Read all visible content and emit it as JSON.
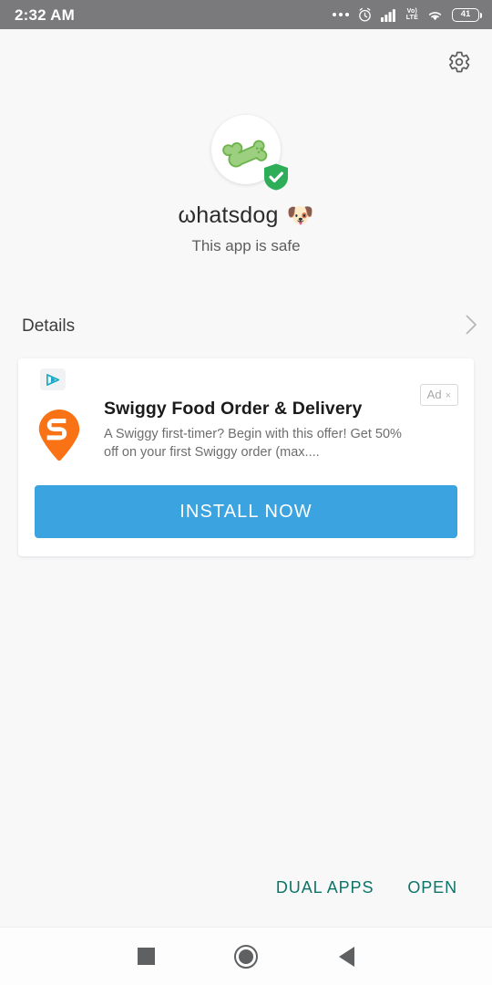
{
  "status_bar": {
    "time": "2:32 AM",
    "background": "#7a7a7c",
    "icons": [
      "more-dots-icon",
      "alarm-clock-icon",
      "signal-bars-icon",
      "volte-icon",
      "wifi-icon",
      "battery-icon"
    ],
    "volte_top": "Vo)",
    "volte_bottom": "LTE",
    "battery_level": "41"
  },
  "toolbar": {
    "settings_icon": "gear-icon"
  },
  "app": {
    "icon": "dog-bone-icon",
    "icon_background": "#ffffff",
    "bone_color": "#86c96a",
    "safe_badge_icon": "shield-check-icon",
    "safe_badge_color": "#2fae5a",
    "name": "ωhatsdog",
    "emoji": "🐶",
    "subtitle": "This app is safe"
  },
  "details": {
    "label": "Details",
    "chevron_icon": "chevron-right-icon"
  },
  "ad": {
    "adchoices_icon": "ad-play-icon",
    "badge_label": "Ad",
    "badge_close": "×",
    "advertiser_icon": "swiggy-logo-icon",
    "advertiser_color": "#f97316",
    "title": "Swiggy Food Order & Delivery",
    "description": "A Swiggy first-timer? Begin with this offer! Get 50% off on your first Swiggy order (max....",
    "cta_label": "INSTALL NOW",
    "cta_color": "#3ba3e0"
  },
  "bottom_actions": {
    "dual_apps_label": "DUAL APPS",
    "open_label": "OPEN",
    "color": "#0d7468"
  },
  "nav_bar": {
    "recents_icon": "square-recents-icon",
    "home_icon": "circle-home-icon",
    "back_icon": "triangle-back-icon"
  }
}
